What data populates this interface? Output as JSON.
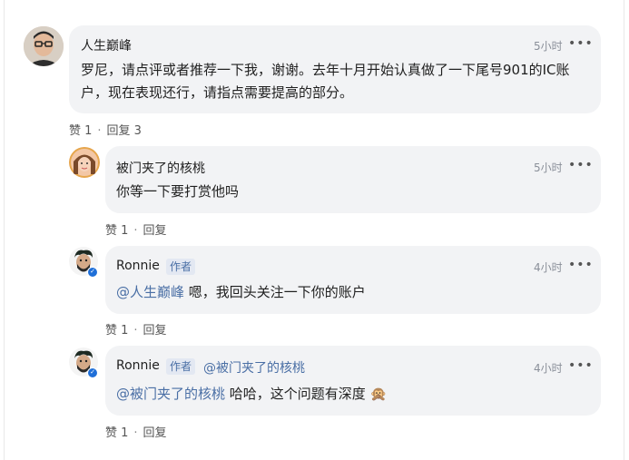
{
  "more_label": "•••",
  "colors": {
    "bubble": "#f2f3f5",
    "mention": "#4a6fa5",
    "verified": "#1f6fd8"
  },
  "comments": [
    {
      "author": "人生巅峰",
      "time": "5小时",
      "text": "罗尼，请点评或者推荐一下我，谢谢。去年十月开始认真做了一下尾号901的IC账户，现在表现还行，请指点需要提高的部分。",
      "like_label": "赞 1",
      "reply_label": "回复 3"
    },
    {
      "author": "被门夹了的核桃",
      "time": "5小时",
      "text": "你等一下要打赏他吗",
      "like_label": "赞 1",
      "reply_label": "回复"
    },
    {
      "author": "Ronnie",
      "author_tag": "作者",
      "time": "4小时",
      "mention": "@人生巅峰",
      "text": " 嗯，我回头关注一下你的账户",
      "like_label": "赞 1",
      "reply_label": "回复"
    },
    {
      "author": "Ronnie",
      "author_tag": "作者",
      "reply_to": "@被门夹了的核桃",
      "time": "4小时",
      "mention": "@被门夹了的核桃",
      "text": " 哈哈，这个问题有深度",
      "emoji": "🙊",
      "like_label": "赞 1",
      "reply_label": "回复"
    }
  ]
}
